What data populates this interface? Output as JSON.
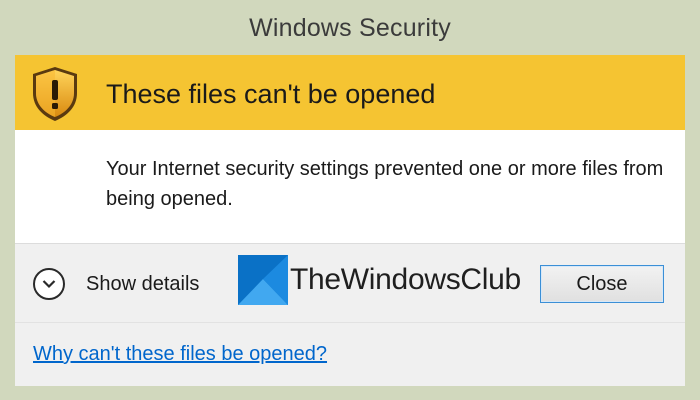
{
  "window": {
    "title": "Windows Security"
  },
  "header": {
    "icon": "shield-warning-icon",
    "heading": "These files can't be opened"
  },
  "body": {
    "message": "Your Internet security settings prevented one or more files from being opened."
  },
  "footer": {
    "details_icon": "chevron-down-icon",
    "details_label": "Show details",
    "close_label": "Close"
  },
  "watermark": {
    "text": "TheWindowsClub"
  },
  "link": {
    "help_text": "Why can't these files be opened?"
  },
  "colors": {
    "frame": "#d1d8bd",
    "header_band": "#f5c432",
    "body": "#ffffff",
    "footer": "#f0f0f0",
    "link": "#0066cc",
    "button_focus_border": "#3b8fd6"
  }
}
